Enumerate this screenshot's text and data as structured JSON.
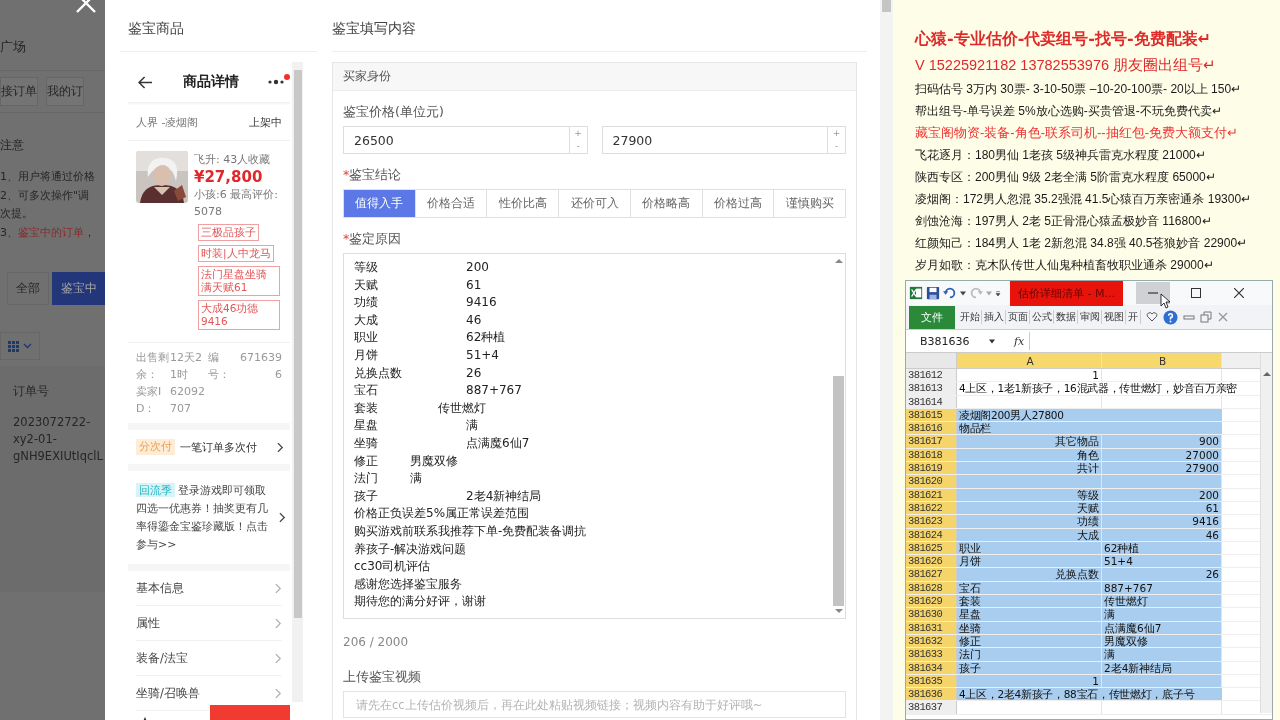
{
  "background_page": {
    "nav_title": "广场",
    "tabs": [
      "接订单",
      "我的订"
    ],
    "notice_title": "注意",
    "notices": [
      {
        "text": "1、用户将通过价格"
      },
      {
        "text": "2、可多次操作\"调"
      },
      {
        "text": "次提。"
      },
      {
        "text": "3、",
        "highlight": "鉴宝中的订单",
        "rest": "，"
      }
    ],
    "filters": [
      {
        "label": "全部",
        "selected": false
      },
      {
        "label": "鉴宝中",
        "selected": true
      }
    ],
    "order_header": "订单号",
    "order_number": "2023072722-xy2-01-gNH9EXIUtIqclL"
  },
  "product_panel": {
    "title": "鉴宝商品",
    "page_title": "商品详情",
    "notification_dot": true,
    "realm": "人界 -凌烟阁",
    "status": "上架中",
    "stats": "飞升: 43人收藏",
    "price": "¥27,800",
    "summary": "小孩:6 最高评价: 5078",
    "tags": [
      "三极品孩子",
      "时装|人中龙马",
      "法门星盘坐骑满天赋61",
      "大成46功德9416"
    ],
    "info_rows": [
      [
        "出售剩",
        "12天2",
        "编",
        "671639"
      ],
      [
        "余：",
        "1时",
        "号：",
        "6"
      ],
      [
        "卖家I",
        "62092"
      ],
      [
        "D：",
        "707"
      ]
    ],
    "installment": {
      "tag": "分次付",
      "text": "一笔订单多次付"
    },
    "promo": {
      "tag": "回流季",
      "text": "登录游戏即可领取四选一优惠券！抽奖更有几率得鎏金宝鉴珍藏版！点击参与>>"
    },
    "menu": [
      "基本信息",
      "属性",
      "装备/法宝",
      "坐骑/召唤兽"
    ]
  },
  "form": {
    "title": "鉴宝填写内容",
    "section": "买家身份",
    "price_label": "鉴宝价格(单位元)",
    "prices": [
      {
        "value": "26500",
        "up": "+",
        "down": "-"
      },
      {
        "value": "27900",
        "up": "+",
        "down": "-"
      }
    ],
    "conclusion_label": {
      "marker": "*",
      "text": "鉴宝结论"
    },
    "conclusions": [
      {
        "label": "值得入手",
        "selected": true
      },
      {
        "label": "价格合适",
        "selected": false
      },
      {
        "label": "性价比高",
        "selected": false
      },
      {
        "label": "还价可入",
        "selected": false
      },
      {
        "label": "价格略高",
        "selected": false
      },
      {
        "label": "价格过高",
        "selected": false
      },
      {
        "label": "谨慎购买",
        "selected": false
      }
    ],
    "reason_label": {
      "marker": "*",
      "text": "鉴定原因"
    },
    "reason_lines": [
      "等级\t\t\t\t200",
      "天赋\t\t\t\t61",
      "功绩\t\t\t\t9416",
      "大成\t\t\t\t46",
      "职业\t\t\t\t62种植",
      "月饼\t\t\t\t51+4",
      "兑换点数\t\t\t26",
      "宝石\t\t\t\t887+767",
      "套装\t\t\t传世燃灯",
      "星盘\t\t\t\t满",
      "坐骑\t\t\t\t点满魔6仙7",
      "修正\t\t男魔双修",
      "法门\t\t满",
      "孩子\t\t\t\t2老4新神结局",
      "价格正负误差5%属正常误差范围",
      "购买游戏前联系我推荐下单-免费配装备调抗",
      "养孩子-解决游戏问题",
      "cc30司机评估",
      "感谢您选择鉴宝服务",
      "期待您的满分好评，谢谢"
    ],
    "counter": "206 / 2000",
    "video_label": "上传鉴宝视频",
    "video_placeholder": "请先在cc上传估价视频后，再在此处粘贴视频链接；视频内容有助于好评哦~"
  },
  "document": [
    {
      "kind": "title",
      "text": "心猿-专业估价-代卖组号-找号-免费配装↵"
    },
    {
      "kind": "contact",
      "text": "V 15225921182   13782553976 朋友圈出组号↵"
    },
    {
      "kind": "normal",
      "text": "扫码估号 3万内 30票- 3-10-50票  –10-20-100票- 20以上 150↵"
    },
    {
      "kind": "normal",
      "text": "帮出组号-单号误差 5%放心选购-买贵管退-不玩免费代卖↵"
    },
    {
      "kind": "highlight",
      "text": "藏宝阁物资-装备-角色-联系司机--抽红包-免费大额支付↵"
    },
    {
      "kind": "normal",
      "text": "飞花逐月：180男仙 1老孩 5级神兵雷克水程度 21000↵"
    },
    {
      "kind": "normal",
      "text": "陕西专区：200男仙 9级 2老全满 5阶雷克水程度 65000↵"
    },
    {
      "kind": "normal",
      "text": "凌烟阁：172男人忽混 35.2强混 41.5心猿百万亲密通杀 19300↵"
    },
    {
      "kind": "normal",
      "text": "剑蚀沧海：197男人 2老 5正骨混心猿孟极妙音 116800↵"
    },
    {
      "kind": "normal",
      "text": "红颜知己：184男人 1老 2新忽混 34.8强 40.5苍狼妙音 22900↵"
    },
    {
      "kind": "normal",
      "text": "岁月如歌：克木队传世人仙鬼种植畜牧职业通杀 29000↵"
    }
  ],
  "excel": {
    "title": "估价详细清单 - M...",
    "minimize_hovered": true,
    "file_tab": "文件",
    "ribbon_tabs": [
      "开始",
      "插入",
      "页面",
      "公式",
      "数据",
      "审阅",
      "视图",
      "开"
    ],
    "name_box": "B381636",
    "function_label": "fx",
    "columns": [
      "A",
      "B"
    ],
    "rows": [
      {
        "number": "381612",
        "a": "1",
        "numeric": true,
        "selected": false
      },
      {
        "number": "381613",
        "a": "4上区，1老1新孩子，16混武器，传世燃灯，妙音百万亲密",
        "numeric": false,
        "selected": false
      },
      {
        "number": "381614",
        "selected": false
      },
      {
        "number": "381615",
        "a": "凌烟阁200男人27800",
        "numeric": false,
        "selected": true
      },
      {
        "number": "381616",
        "a": "物品栏",
        "numeric": false,
        "selected": true
      },
      {
        "number": "381617",
        "a": "其它物品",
        "b": "900",
        "numeric": true,
        "selected": true
      },
      {
        "number": "381618",
        "a": "角色",
        "b": "27000",
        "numeric": true,
        "selected": true
      },
      {
        "number": "381619",
        "a": "共计",
        "b": "27900",
        "numeric": true,
        "selected": true
      },
      {
        "number": "381620",
        "selected": true
      },
      {
        "number": "381621",
        "a": "等级",
        "b": "200",
        "numeric": true,
        "selected": true
      },
      {
        "number": "381622",
        "a": "天赋",
        "b": "61",
        "numeric": true,
        "selected": true
      },
      {
        "number": "381623",
        "a": "功绩",
        "b": "9416",
        "numeric": true,
        "selected": true
      },
      {
        "number": "381624",
        "a": "大成",
        "b": "46",
        "numeric": true,
        "selected": true
      },
      {
        "number": "381625",
        "a": "职业",
        "b": "62种植",
        "numeric": false,
        "selected": true
      },
      {
        "number": "381626",
        "a": "月饼",
        "b": "51+4",
        "numeric": false,
        "selected": true
      },
      {
        "number": "381627",
        "a": "兑换点数",
        "b": "26",
        "numeric": true,
        "selected": true
      },
      {
        "number": "381628",
        "a": "宝石",
        "b": "887+767",
        "numeric": false,
        "selected": true
      },
      {
        "number": "381629",
        "a": "套装",
        "b": "传世燃灯",
        "numeric": false,
        "selected": true
      },
      {
        "number": "381630",
        "a": "星盘",
        "b": "满",
        "numeric": false,
        "selected": true
      },
      {
        "number": "381631",
        "a": "坐骑",
        "b": "点满魔6仙7",
        "numeric": false,
        "selected": true
      },
      {
        "number": "381632",
        "a": "修正",
        "b": "男魔双修",
        "numeric": false,
        "selected": true
      },
      {
        "number": "381633",
        "a": "法门",
        "b": "满",
        "numeric": false,
        "selected": true
      },
      {
        "number": "381634",
        "a": "孩子",
        "b": "2老4新神结局",
        "numeric": false,
        "selected": true
      },
      {
        "number": "381635",
        "a": "1",
        "numeric": true,
        "selected": true
      },
      {
        "number": "381636",
        "a": "4上区，2老4新孩子，88宝石，传世燃灯，底子号",
        "numeric": false,
        "selected": true
      },
      {
        "number": "381637",
        "selected": false
      }
    ]
  }
}
